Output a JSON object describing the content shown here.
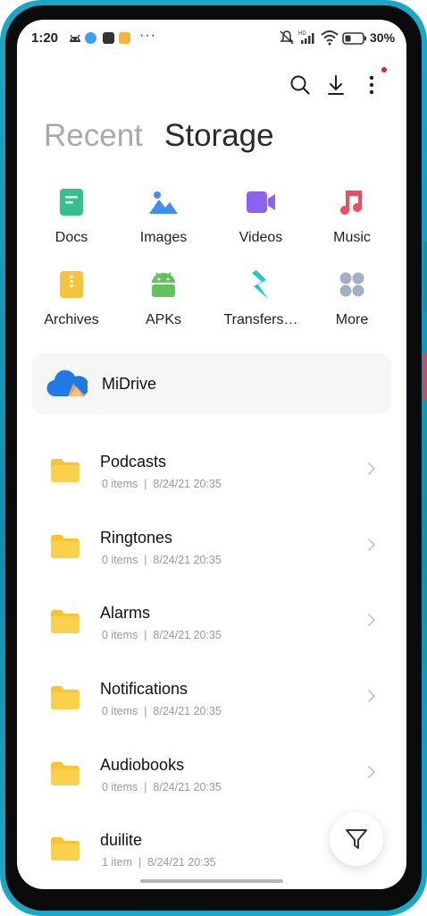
{
  "status_bar": {
    "time": "1:20",
    "battery_percent": "30%"
  },
  "tabs": {
    "recent": "Recent",
    "storage": "Storage"
  },
  "categories": [
    {
      "label": "Docs",
      "icon": "docs-icon",
      "color": "#33c28e"
    },
    {
      "label": "Images",
      "icon": "images-icon",
      "color": "#3f8ef5"
    },
    {
      "label": "Videos",
      "icon": "videos-icon",
      "color": "#8c63f0"
    },
    {
      "label": "Music",
      "icon": "music-icon",
      "color": "#f04c5f"
    },
    {
      "label": "Archives",
      "icon": "archives-icon",
      "color": "#f8c23a"
    },
    {
      "label": "APKs",
      "icon": "apk-icon",
      "color": "#62c45a"
    },
    {
      "label": "Transfers…",
      "icon": "transfers-icon",
      "color": "#22c7c9"
    },
    {
      "label": "More",
      "icon": "more-grid-icon",
      "color": "#a3aec7"
    }
  ],
  "midrive": {
    "label": "MiDrive"
  },
  "folders": [
    {
      "name": "Podcasts",
      "meta": "0 items  |  8/24/21 20:35"
    },
    {
      "name": "Ringtones",
      "meta": "0 items  |  8/24/21 20:35"
    },
    {
      "name": "Alarms",
      "meta": "0 items  |  8/24/21 20:35"
    },
    {
      "name": "Notifications",
      "meta": "0 items  |  8/24/21 20:35"
    },
    {
      "name": "Audiobooks",
      "meta": "0 items  |  8/24/21 20:35"
    },
    {
      "name": "duilite",
      "meta": "1 item  |  8/24/21 20:35"
    }
  ],
  "colors": {
    "folder": "#f9c42d",
    "accent_frame": "#19a9c8",
    "notification_dot": "#e2231a"
  }
}
